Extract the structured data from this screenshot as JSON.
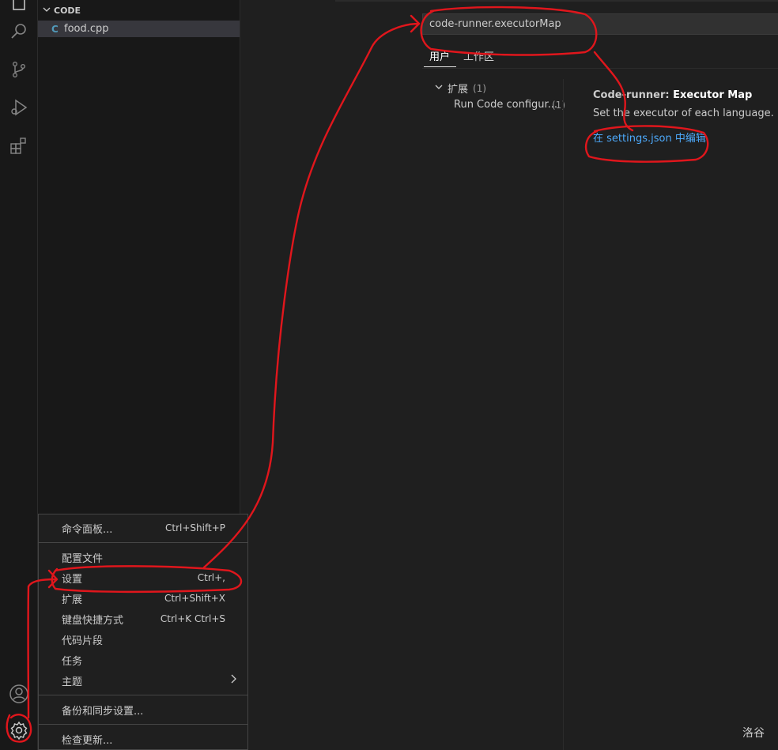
{
  "activity_bar": {
    "icons": [
      "explorer-icon",
      "search-icon",
      "source-control-icon",
      "run-debug-icon",
      "extensions-icon",
      "account-icon",
      "gear-icon"
    ]
  },
  "explorer": {
    "section_title": "CODE",
    "file": {
      "icon": "C",
      "name": "food.cpp"
    }
  },
  "settings": {
    "search_value": "code-runner.executorMap",
    "tabs": [
      "用户",
      "工作区"
    ],
    "active_tab": "用户",
    "toc": {
      "group_label": "扩展",
      "group_count": "(1)",
      "item_label": "Run Code configur...",
      "item_count": "(1)"
    },
    "setting": {
      "category": "Code-runner: ",
      "name": "Executor Map",
      "description": "Set the executor of each language.",
      "edit_link": "在 settings.json 中编辑"
    }
  },
  "menu": {
    "items": [
      {
        "label": "命令面板...",
        "shortcut": "Ctrl+Shift+P"
      },
      {
        "label": "配置文件",
        "shortcut": ""
      },
      {
        "label": "设置",
        "shortcut": "Ctrl+,"
      },
      {
        "label": "扩展",
        "shortcut": "Ctrl+Shift+X"
      },
      {
        "label": "键盘快捷方式",
        "shortcut": "Ctrl+K Ctrl+S"
      },
      {
        "label": "代码片段",
        "shortcut": ""
      },
      {
        "label": "任务",
        "shortcut": ""
      },
      {
        "label": "主题",
        "shortcut": ""
      },
      {
        "label": "备份和同步设置...",
        "shortcut": ""
      },
      {
        "label": "检查更新...",
        "shortcut": ""
      }
    ]
  },
  "watermark": "洛谷",
  "colors": {
    "annotation": "#e0161c",
    "link": "#4daafc"
  }
}
